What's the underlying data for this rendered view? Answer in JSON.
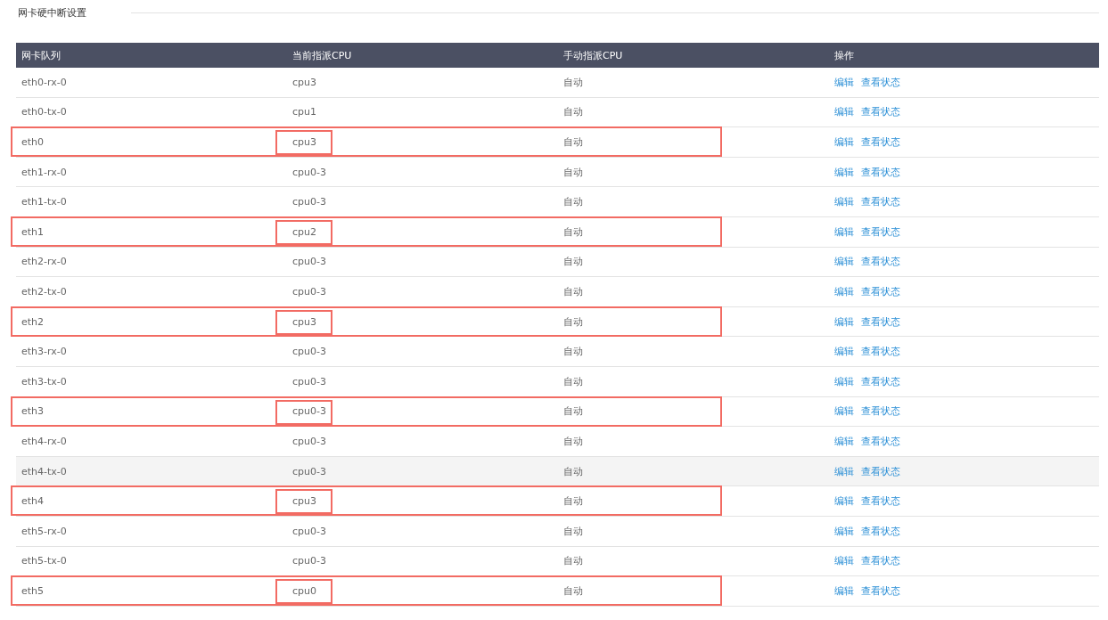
{
  "section": {
    "title": "网卡硬中断设置"
  },
  "table": {
    "columns": [
      "网卡队列",
      "当前指派CPU",
      "手动指派CPU",
      "操作"
    ],
    "rows": [
      {
        "queue": "eth0-rx-0",
        "cpu": "cpu3",
        "manual": "自动",
        "actions": [
          "编辑",
          "查看状态"
        ],
        "highlighted": false,
        "hovered": false
      },
      {
        "queue": "eth0-tx-0",
        "cpu": "cpu1",
        "manual": "自动",
        "actions": [
          "编辑",
          "查看状态"
        ],
        "highlighted": false,
        "hovered": false
      },
      {
        "queue": "eth0",
        "cpu": "cpu3",
        "manual": "自动",
        "actions": [
          "编辑",
          "查看状态"
        ],
        "highlighted": true,
        "hovered": false
      },
      {
        "queue": "eth1-rx-0",
        "cpu": "cpu0-3",
        "manual": "自动",
        "actions": [
          "编辑",
          "查看状态"
        ],
        "highlighted": false,
        "hovered": false
      },
      {
        "queue": "eth1-tx-0",
        "cpu": "cpu0-3",
        "manual": "自动",
        "actions": [
          "编辑",
          "查看状态"
        ],
        "highlighted": false,
        "hovered": false
      },
      {
        "queue": "eth1",
        "cpu": "cpu2",
        "manual": "自动",
        "actions": [
          "编辑",
          "查看状态"
        ],
        "highlighted": true,
        "hovered": false
      },
      {
        "queue": "eth2-rx-0",
        "cpu": "cpu0-3",
        "manual": "自动",
        "actions": [
          "编辑",
          "查看状态"
        ],
        "highlighted": false,
        "hovered": false
      },
      {
        "queue": "eth2-tx-0",
        "cpu": "cpu0-3",
        "manual": "自动",
        "actions": [
          "编辑",
          "查看状态"
        ],
        "highlighted": false,
        "hovered": false
      },
      {
        "queue": "eth2",
        "cpu": "cpu3",
        "manual": "自动",
        "actions": [
          "编辑",
          "查看状态"
        ],
        "highlighted": true,
        "hovered": false
      },
      {
        "queue": "eth3-rx-0",
        "cpu": "cpu0-3",
        "manual": "自动",
        "actions": [
          "编辑",
          "查看状态"
        ],
        "highlighted": false,
        "hovered": false
      },
      {
        "queue": "eth3-tx-0",
        "cpu": "cpu0-3",
        "manual": "自动",
        "actions": [
          "编辑",
          "查看状态"
        ],
        "highlighted": false,
        "hovered": false
      },
      {
        "queue": "eth3",
        "cpu": "cpu0-3",
        "manual": "自动",
        "actions": [
          "编辑",
          "查看状态"
        ],
        "highlighted": true,
        "hovered": false
      },
      {
        "queue": "eth4-rx-0",
        "cpu": "cpu0-3",
        "manual": "自动",
        "actions": [
          "编辑",
          "查看状态"
        ],
        "highlighted": false,
        "hovered": false
      },
      {
        "queue": "eth4-tx-0",
        "cpu": "cpu0-3",
        "manual": "自动",
        "actions": [
          "编辑",
          "查看状态"
        ],
        "highlighted": false,
        "hovered": true
      },
      {
        "queue": "eth4",
        "cpu": "cpu3",
        "manual": "自动",
        "actions": [
          "编辑",
          "查看状态"
        ],
        "highlighted": true,
        "hovered": false
      },
      {
        "queue": "eth5-rx-0",
        "cpu": "cpu0-3",
        "manual": "自动",
        "actions": [
          "编辑",
          "查看状态"
        ],
        "highlighted": false,
        "hovered": false
      },
      {
        "queue": "eth5-tx-0",
        "cpu": "cpu0-3",
        "manual": "自动",
        "actions": [
          "编辑",
          "查看状态"
        ],
        "highlighted": false,
        "hovered": false
      },
      {
        "queue": "eth5",
        "cpu": "cpu0",
        "manual": "自动",
        "actions": [
          "编辑",
          "查看状态"
        ],
        "highlighted": true,
        "hovered": false
      }
    ]
  }
}
